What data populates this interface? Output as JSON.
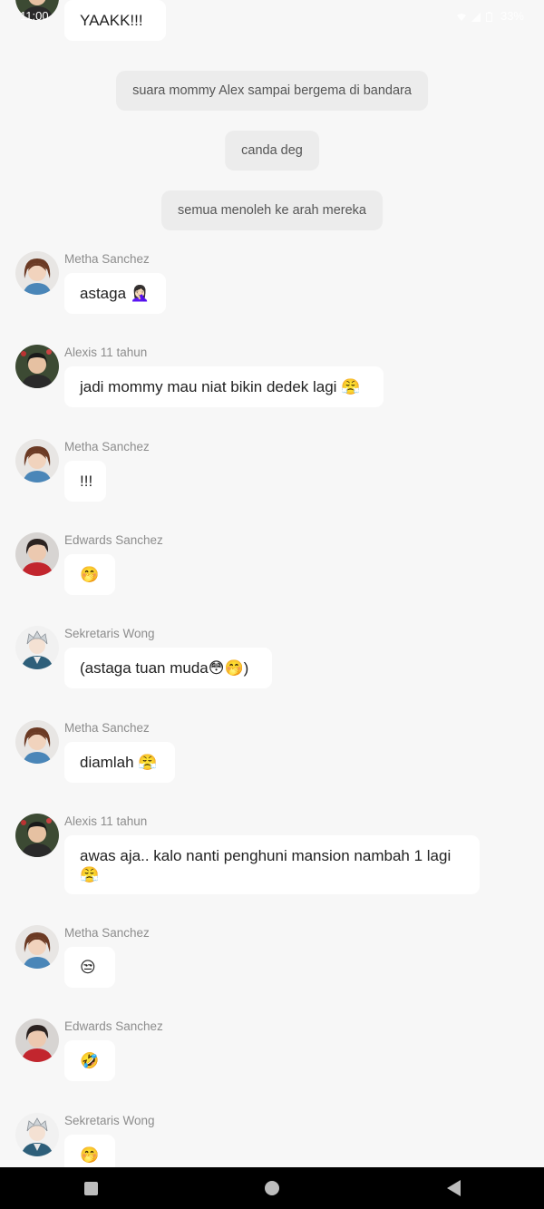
{
  "status_bar": {
    "time": "11:00",
    "battery": "33%"
  },
  "messages": [
    {
      "type": "chat",
      "avatar": "avatar-alexis-icon",
      "sender": "",
      "text": "YAAKK!!!"
    },
    {
      "type": "narration",
      "text": "suara mommy Alex sampai bergema di bandara"
    },
    {
      "type": "narration",
      "text": "canda deg"
    },
    {
      "type": "narration",
      "text": "semua menoleh ke arah mereka"
    },
    {
      "type": "chat",
      "avatar": "avatar-metha-icon",
      "sender": "Metha Sanchez",
      "text": "astaga 🤦🏻‍♀️"
    },
    {
      "type": "chat",
      "avatar": "avatar-alexis-icon",
      "sender": "Alexis 11 tahun",
      "text": "jadi mommy mau niat bikin dedek lagi 😤"
    },
    {
      "type": "chat",
      "avatar": "avatar-metha-icon",
      "sender": "Metha Sanchez",
      "text": "!!!"
    },
    {
      "type": "chat",
      "avatar": "avatar-edwards-icon",
      "sender": "Edwards Sanchez",
      "text": "🤭"
    },
    {
      "type": "chat",
      "avatar": "avatar-wong-icon",
      "sender": "Sekretaris Wong",
      "text": "(astaga tuan muda😳🤭)"
    },
    {
      "type": "chat",
      "avatar": "avatar-metha-icon",
      "sender": "Metha Sanchez",
      "text": "diamlah 😤"
    },
    {
      "type": "chat",
      "avatar": "avatar-alexis-icon",
      "sender": "Alexis 11 tahun",
      "text": "awas aja.. kalo nanti penghuni mansion nambah 1 lagi 😤"
    },
    {
      "type": "chat",
      "avatar": "avatar-metha-icon",
      "sender": "Metha Sanchez",
      "text": "😒"
    },
    {
      "type": "chat",
      "avatar": "avatar-edwards-icon",
      "sender": "Edwards Sanchez",
      "text": "🤣"
    },
    {
      "type": "chat",
      "avatar": "avatar-wong-icon",
      "sender": "Sekretaris Wong",
      "text": "🤭"
    }
  ],
  "colors": {
    "background": "#f7f7f7",
    "bubble": "#ffffff",
    "narration_bubble": "#ececec",
    "sender_text": "#8d8d8d",
    "nav_bar": "#000000"
  }
}
